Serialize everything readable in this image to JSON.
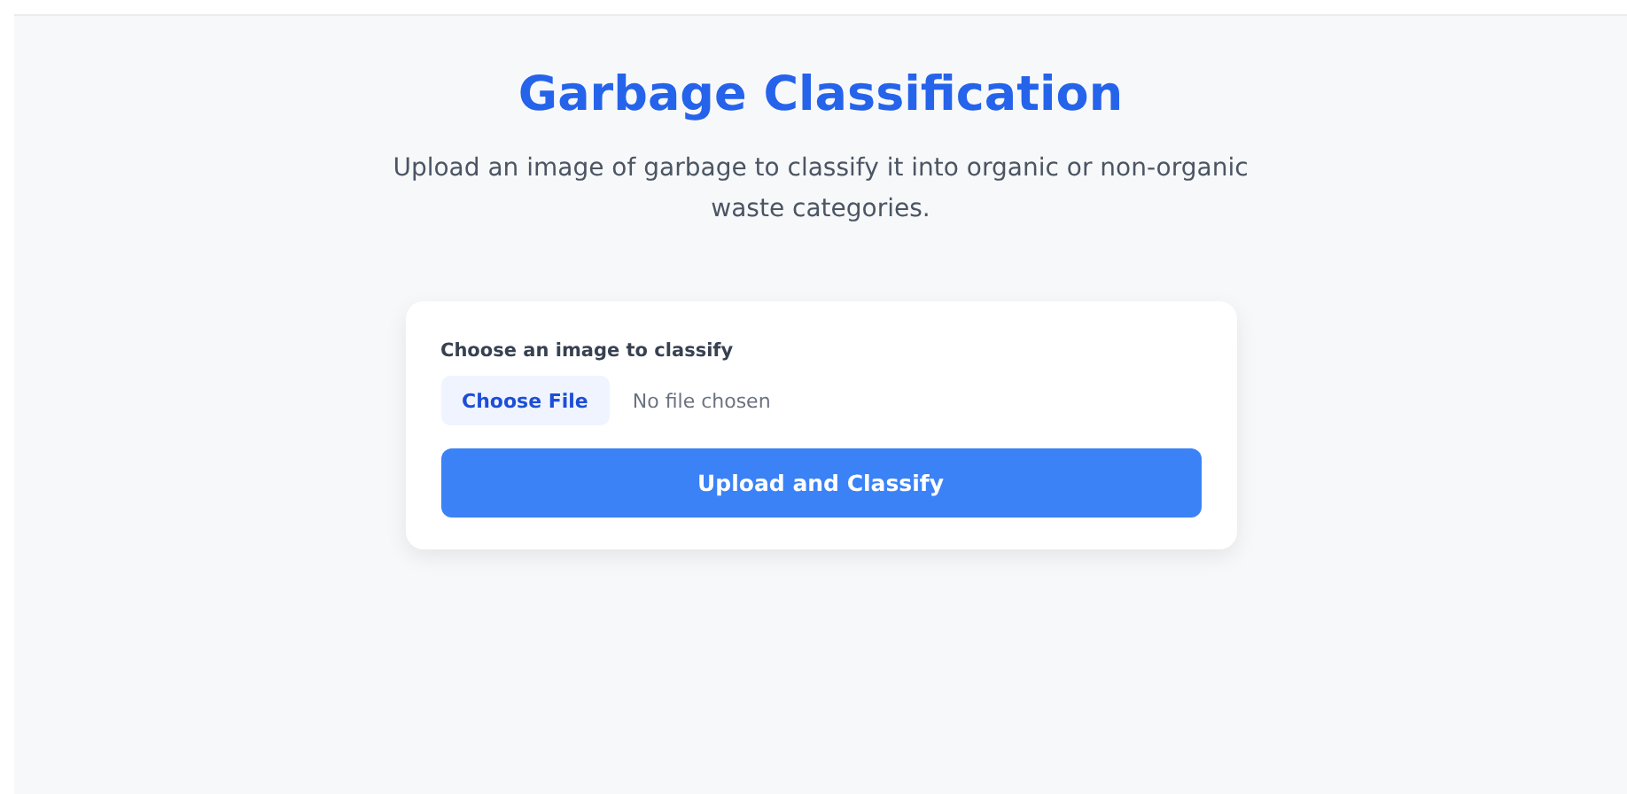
{
  "header": {
    "title": "Garbage Classification",
    "subtitle": "Upload an image of garbage to classify it into organic or non-organic waste categories."
  },
  "upload_form": {
    "label": "Choose an image to classify",
    "file_button": "Choose File",
    "file_status": "No file chosen",
    "submit_button": "Upload and Classify"
  }
}
